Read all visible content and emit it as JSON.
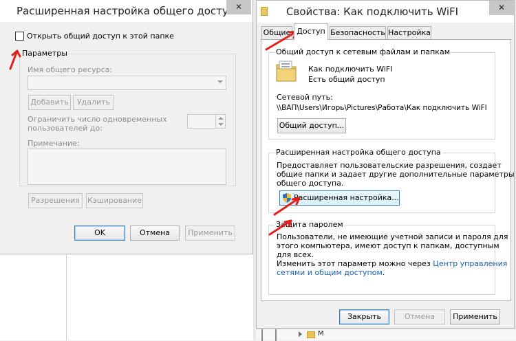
{
  "advanced_dialog": {
    "title": "Расширенная настройка общего доступа",
    "close_glyph": "✕",
    "share_checkbox_label": "Открыть общий доступ к этой папке",
    "params_group_title": "Параметры",
    "share_name_label": "Имя общего ресурса:",
    "add_label": "Добавить",
    "remove_label": "Удалить",
    "limit_label_line1": "Ограничить число одновременных",
    "limit_label_line2": "пользователей до:",
    "comment_label": "Примечание:",
    "permissions_label": "Разрешения",
    "caching_label": "Кэширование",
    "ok_label": "OK",
    "cancel_label": "Отмена",
    "apply_label": "Применить"
  },
  "properties_dialog": {
    "title": "Свойства: Как подключить WiFI",
    "close_glyph": "✕",
    "tabs": [
      {
        "label": "Общие"
      },
      {
        "label": "Доступ"
      },
      {
        "label": "Безопасность"
      },
      {
        "label": "Настройка"
      }
    ],
    "network_share_group_title": "Общий доступ к сетевым файлам и папкам",
    "folder_name": "Как подключить WiFI",
    "folder_status": "Есть общий доступ",
    "network_path_label": "Сетевой путь:",
    "network_path_value": "\\\\ВАП\\Users\\Игорь\\Pictures\\Работа\\Как подключить WiFI",
    "share_button_label": "Общий доступ...",
    "advanced_group_title": "Расширенная настройка общего доступа",
    "advanced_desc_line1": "Предоставляет пользовательские разрешения, создает",
    "advanced_desc_line2": "общие папки и задает другие дополнительные параметры",
    "advanced_desc_line3": "общего доступа.",
    "advanced_button_label": "Расширенная настройка...",
    "password_group_title": "Защита паролем",
    "password_desc_line1": "Пользователи, не имеющие учетной записи и пароля для",
    "password_desc_line2": "этого компьютера, имеют доступ к папкам, доступным",
    "password_desc_line3": "для всех.",
    "password_change_prefix": "Изменить этот параметр можно через ",
    "password_link_line1": "Центр управления",
    "password_link_line2": "сетями и общим доступом",
    "password_change_suffix": ".",
    "close_label": "Закрыть",
    "cancel_label": "Отмена",
    "apply_label": "Применить"
  },
  "background": {
    "explorer_tree_text": "М"
  },
  "colors": {
    "annotation_arrow": "#e0201b",
    "link": "#1a5fb4",
    "folder_yellow": "#e8c862",
    "shield_blue": "#2f6fc8",
    "shield_yellow": "#f2c230"
  }
}
